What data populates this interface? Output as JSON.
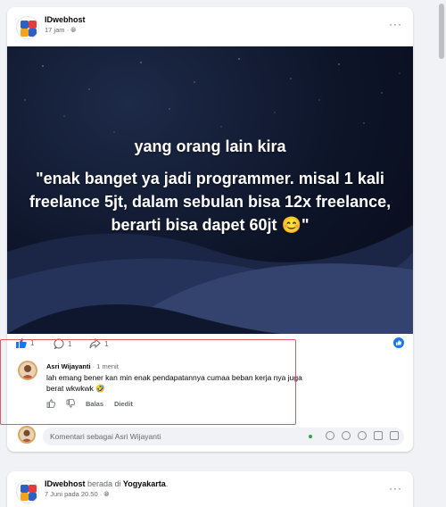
{
  "post": {
    "author": "IDwebhost",
    "time": "17 jam · ",
    "image_text": {
      "line1": "yang orang lain kira",
      "line2": "\"enak banget ya jadi programmer. misal 1 kali freelance 5jt, dalam sebulan bisa 12x freelance, berarti bisa dapet 60jt 😊\""
    },
    "stats": {
      "likes": "1",
      "comments": "1",
      "shares": "1"
    }
  },
  "comment": {
    "author": "Asri Wijayanti",
    "time": " · 1 menit",
    "text": "lah emang bener kan min enak pendapatannya cumaa beban kerja nya juga berat wkwkwk 🤣",
    "reply_label": "Balas",
    "edited_label": "Diedit"
  },
  "composer": {
    "placeholder": "Komentari sebagai Asri Wijayanti"
  },
  "next_post": {
    "author": "IDwebhost",
    "at_label": "berada di",
    "location": "Yogyakarta",
    "time": "7 Juni pada 20.50 · "
  },
  "colors": {
    "brand_blue": "#1877f2",
    "highlight": "#e05a6a"
  }
}
